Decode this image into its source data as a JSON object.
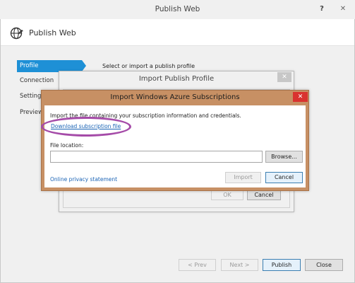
{
  "window": {
    "title": "Publish Web",
    "help_label": "?",
    "close_glyph": "✕"
  },
  "header": {
    "icon": "globe-publish-icon",
    "title": "Publish Web"
  },
  "nav": {
    "items": [
      {
        "label": "Profile",
        "selected": true
      },
      {
        "label": "Connection",
        "selected": false
      },
      {
        "label": "Settings",
        "selected": false
      },
      {
        "label": "Preview",
        "selected": false
      }
    ]
  },
  "profile_page": {
    "heading": "Select or import a publish profile"
  },
  "footer": {
    "prev_label": "< Prev",
    "next_label": "Next >",
    "publish_label": "Publish",
    "close_label": "Close"
  },
  "import_profile_dialog": {
    "title": "Import Publish Profile",
    "close_glyph": "✕",
    "ok_label": "OK",
    "cancel_label": "Cancel"
  },
  "azure_dialog": {
    "title": "Import Windows Azure Subscriptions",
    "close_glyph": "✕",
    "instruction": "Import the file containing your subscription information and credentials.",
    "download_link": "Download subscription file",
    "file_location_label": "File location:",
    "file_location_value": "",
    "browse_label": "Browse...",
    "privacy_link": "Online privacy statement",
    "import_label": "Import",
    "cancel_label": "Cancel",
    "highlight_color": "#a54ba8",
    "frame_color": "#c79064"
  },
  "colors": {
    "accent": "#1e90d6",
    "link": "#1a63b5",
    "close_red": "#d9322f"
  }
}
